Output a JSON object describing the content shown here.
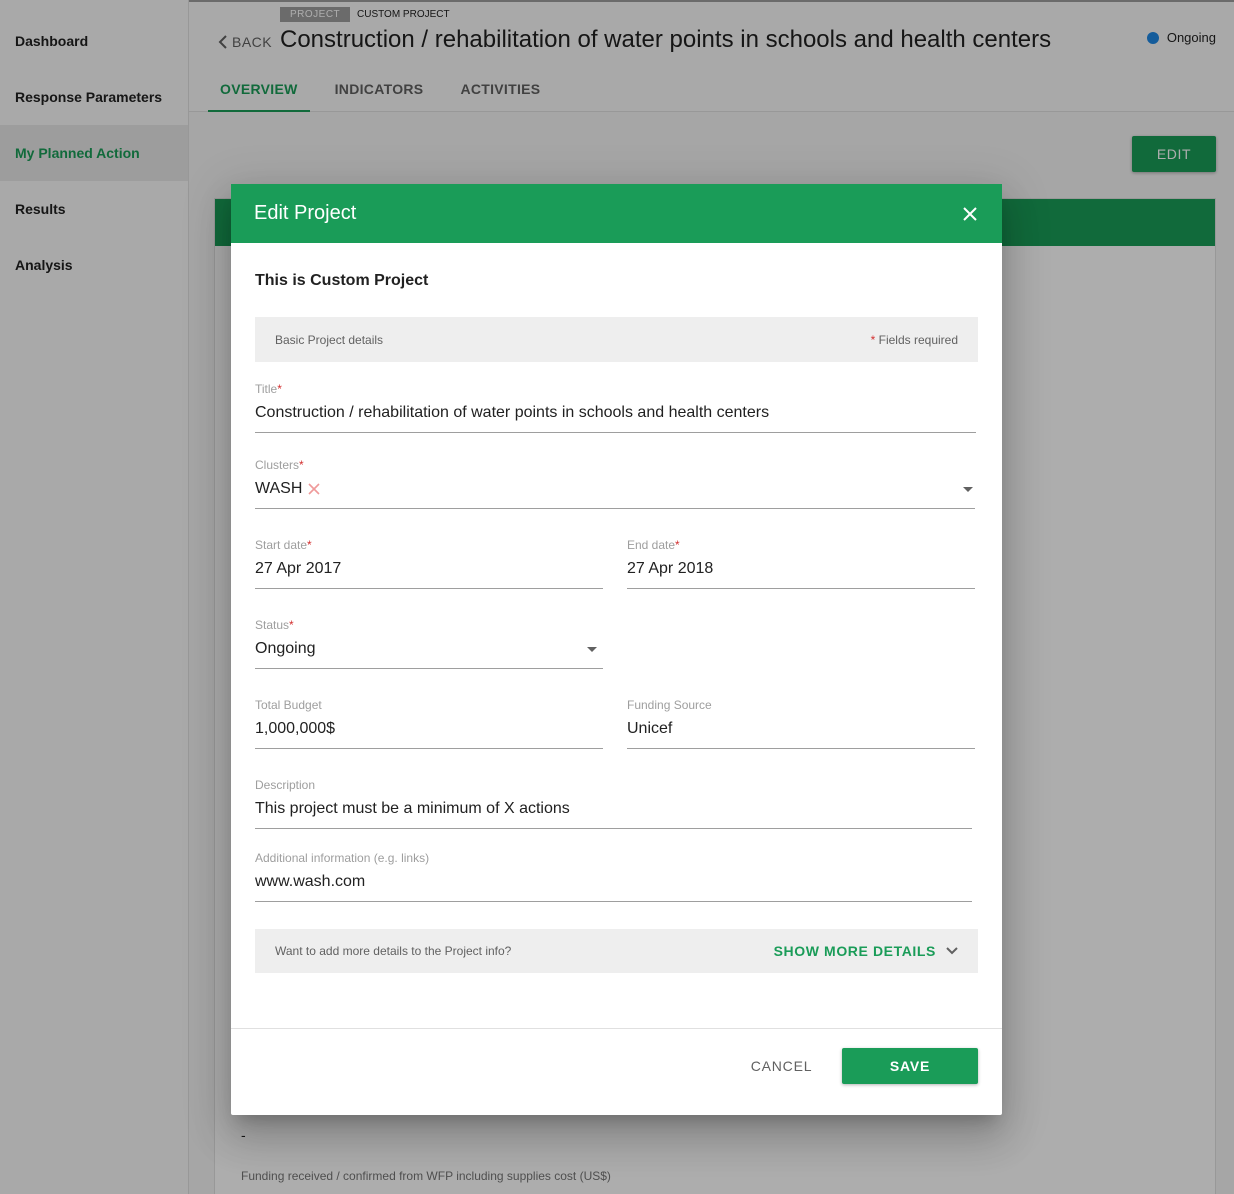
{
  "sidebar": {
    "items": [
      {
        "label": "Dashboard"
      },
      {
        "label": "Response Parameters"
      },
      {
        "label": "My Planned Action"
      },
      {
        "label": "Results"
      },
      {
        "label": "Analysis"
      }
    ]
  },
  "header": {
    "tag_project": "PROJECT",
    "tag_custom": "CUSTOM PROJECT",
    "back_label": "BACK",
    "title": "Construction / rehabilitation of water points in schools and health centers",
    "status": "Ongoing",
    "tabs": [
      {
        "label": "OVERVIEW"
      },
      {
        "label": "INDICATORS"
      },
      {
        "label": "ACTIVITIES"
      }
    ]
  },
  "page": {
    "edit_label": "EDIT",
    "dash": "-",
    "funding_label": "Funding received / confirmed from WFP including supplies cost (US$)"
  },
  "modal": {
    "title": "Edit Project",
    "subtitle": "This is Custom Project",
    "section_title": "Basic Project details",
    "required_note": "Fields required",
    "fields": {
      "title": {
        "label": "Title",
        "value": "Construction / rehabilitation of water points in schools and health centers"
      },
      "clusters": {
        "label": "Clusters",
        "value": "WASH"
      },
      "start_date": {
        "label": "Start date",
        "value": "27 Apr 2017"
      },
      "end_date": {
        "label": "End date",
        "value": "27 Apr 2018"
      },
      "status": {
        "label": "Status",
        "value": "Ongoing"
      },
      "budget": {
        "label": "Total Budget",
        "value": "1,000,000$"
      },
      "funding": {
        "label": "Funding Source",
        "value": "Unicef"
      },
      "description": {
        "label": "Description",
        "value": "This project must be a minimum of X actions"
      },
      "additional": {
        "label": "Additional information (e.g. links)",
        "value": "www.wash.com"
      }
    },
    "more_prompt": "Want to add more details to the Project info?",
    "show_more_label": "SHOW MORE DETAILS",
    "cancel_label": "CANCEL",
    "save_label": "SAVE"
  },
  "colors": {
    "accent": "#1a9c58",
    "status_dot": "#1e88e5",
    "required": "#d32f2f"
  }
}
